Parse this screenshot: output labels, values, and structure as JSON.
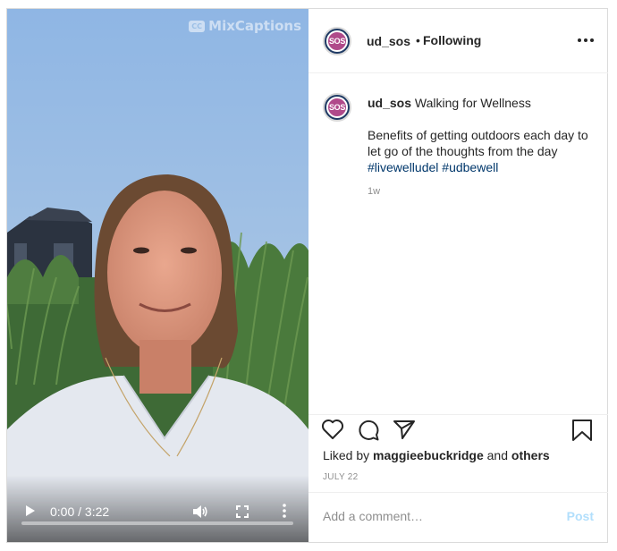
{
  "video": {
    "watermark": "MixCaptions",
    "watermark_badge": "CC",
    "time_display": "0:00 / 3:22",
    "progress_fraction": 0,
    "icons": [
      "play-icon",
      "volume-icon",
      "fullscreen-icon",
      "more-vert-icon"
    ]
  },
  "header": {
    "avatar_text": "SOS",
    "username": "ud_sos",
    "separator": "•",
    "follow_status": "Following"
  },
  "caption": {
    "avatar_text": "SOS",
    "username": "ud_sos",
    "title": "Walking for Wellness",
    "body": "Benefits of getting outdoors each day to let go of the thoughts from the day",
    "hashtags": [
      "#livewelludel",
      "#udbewell"
    ],
    "age": "1w"
  },
  "actions": {
    "icons": [
      "heart-icon",
      "comment-icon",
      "share-icon",
      "bookmark-icon"
    ]
  },
  "likes": {
    "prefix": "Liked by",
    "user": "maggieebuckridge",
    "conjunction": "and",
    "others": "others"
  },
  "date": "JULY 22",
  "comment": {
    "placeholder": "Add a comment…",
    "post_label": "Post"
  },
  "colors": {
    "link": "#00376b",
    "post_disabled": "#b2dffc",
    "sky": "#9cc0e6",
    "avatar_ring": "#1f3a64",
    "avatar_fill": "#b04a8a"
  }
}
